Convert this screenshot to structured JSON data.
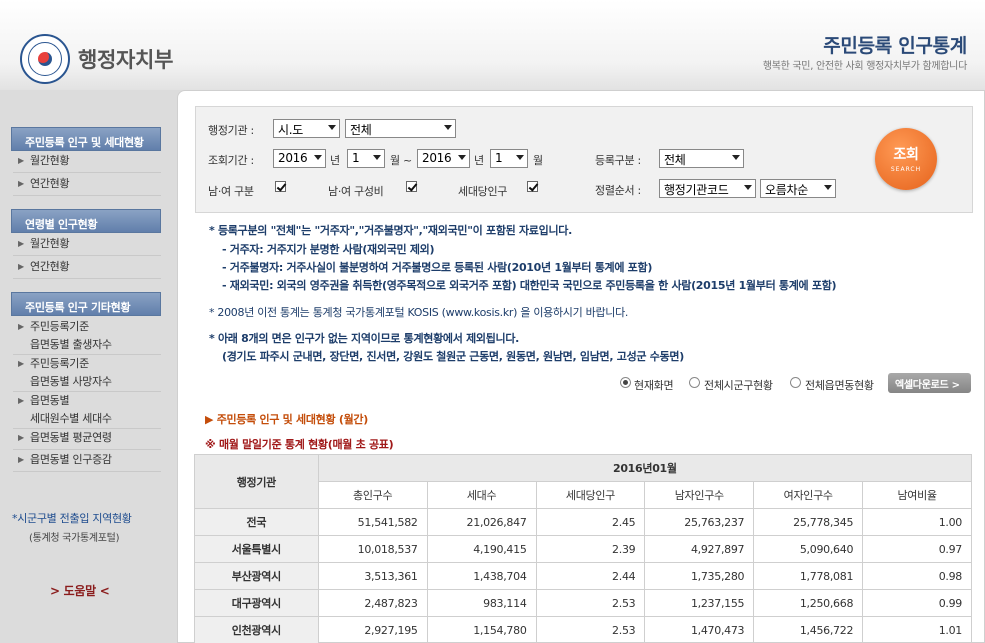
{
  "header": {
    "logo_text": "행정자치부",
    "title": "주민등록 인구통계",
    "subtitle": "행복한 국민, 안전한 사회 행정자치부가 함께합니다"
  },
  "sidebar": {
    "sections": [
      {
        "title": "주민등록 인구 및 세대현황",
        "items": [
          "월간현황",
          "연간현황"
        ]
      },
      {
        "title": "연령별 인구현황",
        "items": [
          "월간현황",
          "연간현황"
        ]
      },
      {
        "title": "주민등록 인구 기타현황",
        "items": [
          [
            "주민등록기준",
            "읍면동별 출생자수"
          ],
          [
            "주민등록기준",
            "읍면동별 사망자수"
          ],
          [
            "읍면동별",
            "세대원수별 세대수"
          ],
          [
            "읍면동별 평균연령"
          ],
          [
            "읍면동별 인구증감"
          ]
        ]
      }
    ],
    "link": "*시군구별 전출입 지역현황",
    "link_sub": "(통계청 국가통계포털)",
    "help": "> 도움말 <"
  },
  "search": {
    "agency_label": "행정기관 :",
    "agency_level": "시.도",
    "agency_value": "전체",
    "period_label": "조회기간 :",
    "from_year": "2016",
    "year_unit": "년",
    "from_month": "1",
    "month_unit": "월 ~",
    "to_year": "2016",
    "to_month": "1",
    "month_unit_end": "월",
    "reg_label": "등록구분 :",
    "reg_value": "전체",
    "sex_label": "남·여 구분",
    "ratio_label": "남·여 구성비",
    "hh_label": "세대당인구",
    "sort_label": "정렬순서 :",
    "sort_key": "행정기관코드",
    "sort_order": "오름차순",
    "button": "조회",
    "button_en": "SEARCH"
  },
  "notes": [
    {
      "text": "* 등록구분의 \"전체\"는 \"거주자\",\"거주불명자\",\"재외국민\"이 포함된 자료입니다.",
      "bold": true
    },
    {
      "text": "- 거주자: 거주지가 분명한 사람(재외국민 제외)",
      "bold": true
    },
    {
      "text": "- 거주불명자: 거주사실이 불분명하여 거주불명으로 등록된 사람(2010년 1월부터 통계에 포함)",
      "bold": true
    },
    {
      "text": "- 재외국민: 외국의 영주권을 취득한(영주목적으로 외국거주 포함) 대한민국 국민으로 주민등록을 한 사람(2015년 1월부터 통계에 포함)",
      "bold": true
    },
    {
      "text": "* 2008년 이전 통계는 통계청 국가통계포털 KOSIS (www.kosis.kr) 을 이용하시기 바랍니다.",
      "bold": false
    },
    {
      "text": "* 아래 8개의 면은 인구가 없는 지역이므로 통계현황에서 제외됩니다.",
      "bold": true
    },
    {
      "text": "(경기도 파주시 군내면, 장단면, 진서면, 강원도 철원군 근동면, 원동면, 원남면, 임남면, 고성군 수동면)",
      "bold": true
    }
  ],
  "view": {
    "options": [
      "현재화면",
      "전체시군구현황",
      "전체읍면동현황"
    ],
    "selected": 0,
    "excel": "엑셀다운로드 >"
  },
  "section_title": "주민등록 인구 및 세대현황 (월간)",
  "section_marker": "▶",
  "table_title": "매월 말일기준 통계 현황(매월 초 공표)",
  "table_marker": "※",
  "table": {
    "agency_header": "행정기관",
    "period": "2016년01월",
    "columns": [
      "총인구수",
      "세대수",
      "세대당인구",
      "남자인구수",
      "여자인구수",
      "남여비율"
    ],
    "rows": [
      {
        "name": "전국",
        "values": [
          "51,541,582",
          "21,026,847",
          "2.45",
          "25,763,237",
          "25,778,345",
          "1.00"
        ]
      },
      {
        "name": "서울특별시",
        "values": [
          "10,018,537",
          "4,190,415",
          "2.39",
          "4,927,897",
          "5,090,640",
          "0.97"
        ]
      },
      {
        "name": "부산광역시",
        "values": [
          "3,513,361",
          "1,438,704",
          "2.44",
          "1,735,280",
          "1,778,081",
          "0.98"
        ]
      },
      {
        "name": "대구광역시",
        "values": [
          "2,487,823",
          "983,114",
          "2.53",
          "1,237,155",
          "1,250,668",
          "0.99"
        ]
      },
      {
        "name": "인천광역시",
        "values": [
          "2,927,195",
          "1,154,780",
          "2.53",
          "1,470,473",
          "1,456,722",
          "1.01"
        ]
      }
    ]
  }
}
